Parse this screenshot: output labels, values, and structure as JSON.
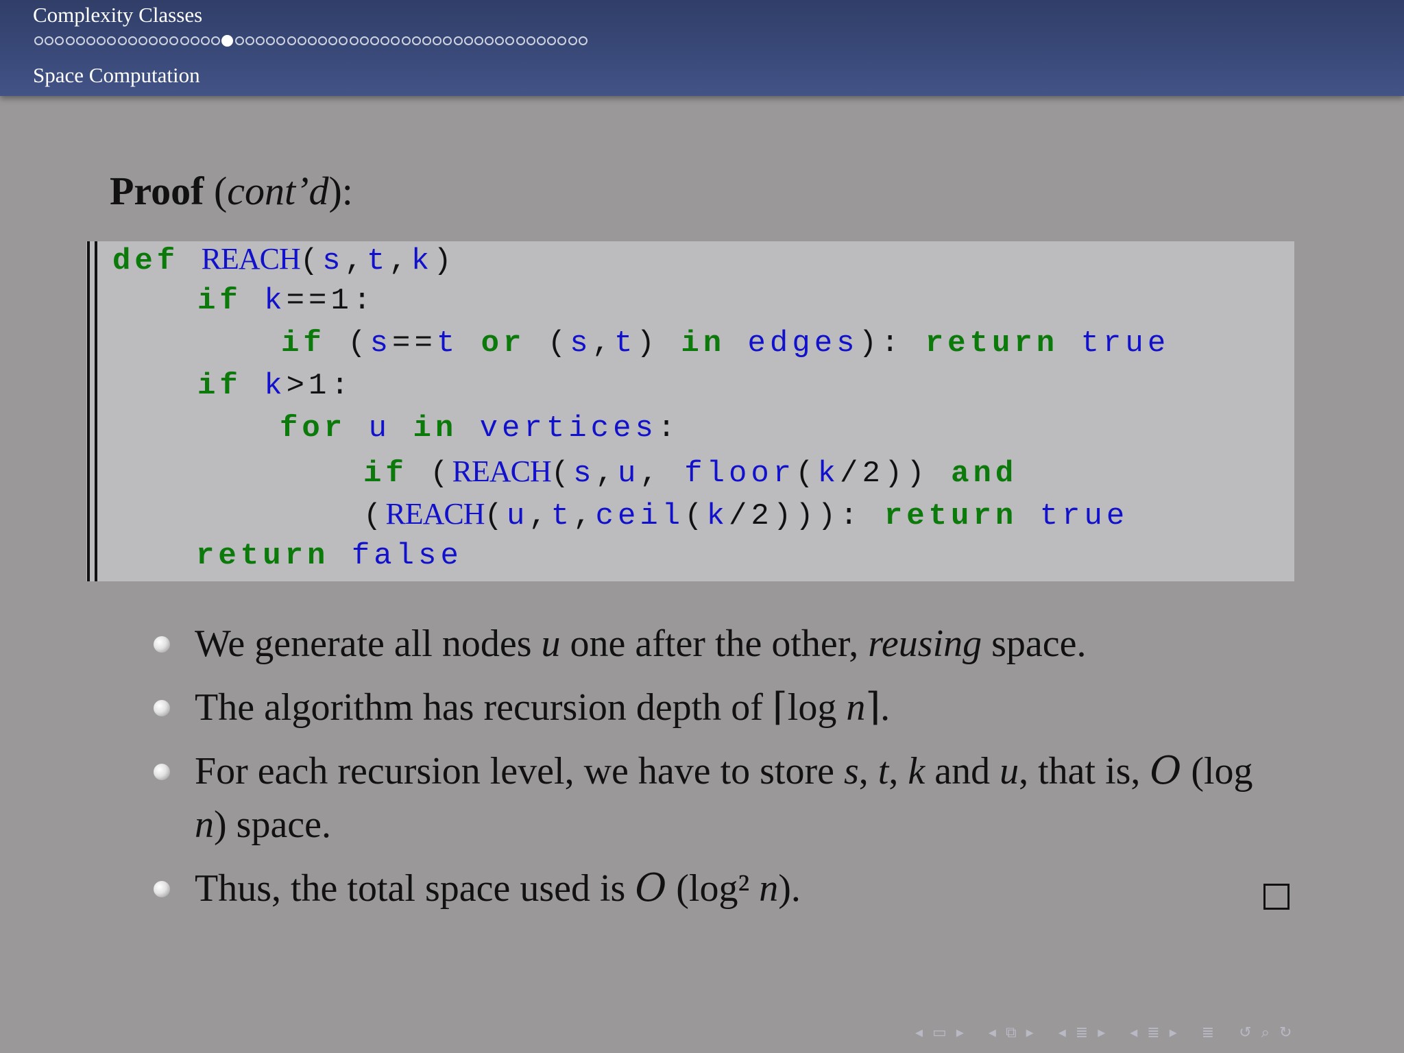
{
  "header": {
    "section_title": "Complexity Classes",
    "subsection_title": "Space Computation",
    "progress": {
      "total": 53,
      "current_index": 18
    }
  },
  "frame": {
    "title_bold": "Proof",
    "title_italic": "cont’d",
    "title_open": "(",
    "title_close": "):"
  },
  "code": {
    "lines": [
      "def REACH(s,t,k)",
      "if k==1:",
      "if (s==t or (s,t) in edges): return true",
      "if k>1:",
      "for u in vertices:",
      "if (REACH(s,u, floor(k/2)) and",
      "(REACH(u,t,ceil(k/2))): return true",
      "return false"
    ]
  },
  "bullets": [
    "We generate all nodes u one after the other, reusing space.",
    "The algorithm has recursion depth of ⌈log n⌉.",
    "For each recursion level, we have to store s, t, k and u, that is, 𝒪 (log n) space.",
    "Thus, the total space used is 𝒪 (log² n)."
  ],
  "icons": {
    "qed": "qed-square-icon",
    "nav": [
      "nav-prev-frame-icon",
      "nav-frame-icon",
      "nav-next-frame-icon",
      "nav-prev-slide-icon",
      "nav-slide-icon",
      "nav-next-slide-icon",
      "nav-prev-subsection-icon",
      "nav-subsection-icon",
      "nav-next-subsection-icon",
      "nav-prev-section-icon",
      "nav-section-icon",
      "nav-next-section-icon",
      "nav-outline-icon",
      "nav-back-icon",
      "nav-search-icon",
      "nav-forward-icon"
    ]
  },
  "colors": {
    "header_bg": "#3a4a7a",
    "page_bg": "#9a9899",
    "code_bg": "#bcbbbd",
    "keyword": "#0b7a0b",
    "identifier": "#1111cc"
  }
}
